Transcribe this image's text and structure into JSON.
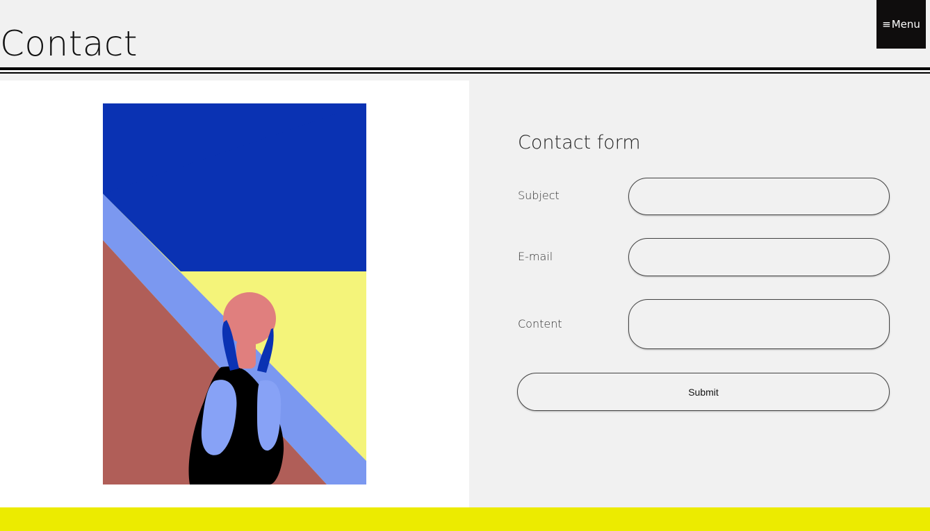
{
  "page": {
    "title": "Contact"
  },
  "menu": {
    "icon": "hamburger-icon",
    "icon_glyph": "≡",
    "label": "Menu"
  },
  "contact_form": {
    "title": "Contact form",
    "fields": [
      {
        "label": "Subject",
        "value": "",
        "placeholder": ""
      },
      {
        "label": "E-mail",
        "value": "",
        "placeholder": ""
      },
      {
        "label": "Content",
        "value": "",
        "placeholder": ""
      }
    ],
    "submit_label": "Submit"
  },
  "colors": {
    "menu_background": "#0f0d0d",
    "footer_band": "#eceb00",
    "artwork_sky": "#0a32b3",
    "artwork_stripe": "#7b98f0",
    "artwork_floor": "#b05e58",
    "artwork_wall": "#f4f47a",
    "artwork_face": "#e07f7e",
    "artwork_dress": "#000000",
    "artwork_sleeve": "#87a2f6"
  }
}
